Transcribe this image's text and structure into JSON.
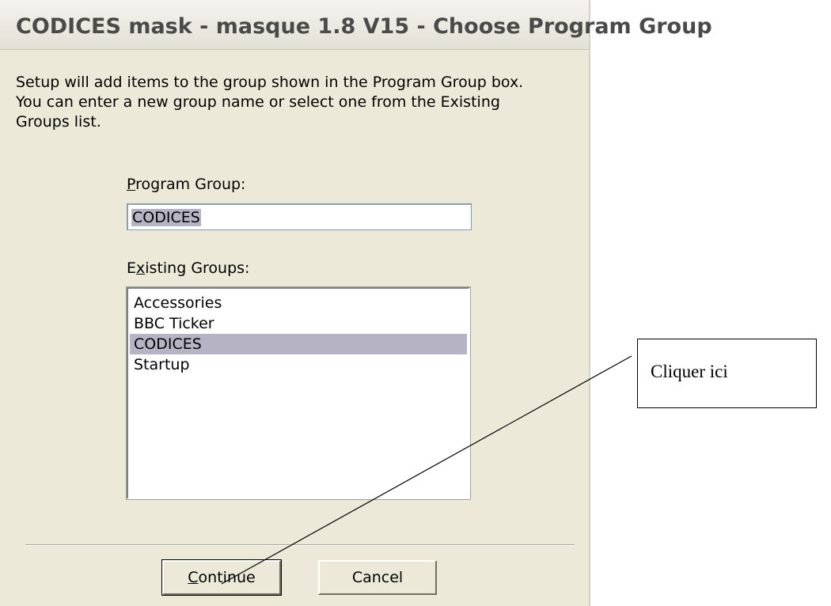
{
  "window": {
    "title": "CODICES mask - masque 1.8 V15 - Choose Program Group"
  },
  "instructions": [
    "Setup will add items to the group shown in the Program Group box.",
    "You can enter a new group name or select one from the Existing",
    "Groups list."
  ],
  "program_group": {
    "label_prefix": "",
    "label_accel": "P",
    "label_rest": "rogram Group:",
    "value": "CODICES"
  },
  "existing_groups": {
    "label_prefix": "E",
    "label_accel": "x",
    "label_rest": "isting Groups:",
    "items": [
      "Accessories",
      "BBC Ticker",
      "CODICES",
      "Startup"
    ],
    "selected": "CODICES"
  },
  "buttons": {
    "continue_accel": "C",
    "continue_rest": "ontinue",
    "cancel": "Cancel"
  },
  "annotation": {
    "text": "Cliquer ici"
  }
}
